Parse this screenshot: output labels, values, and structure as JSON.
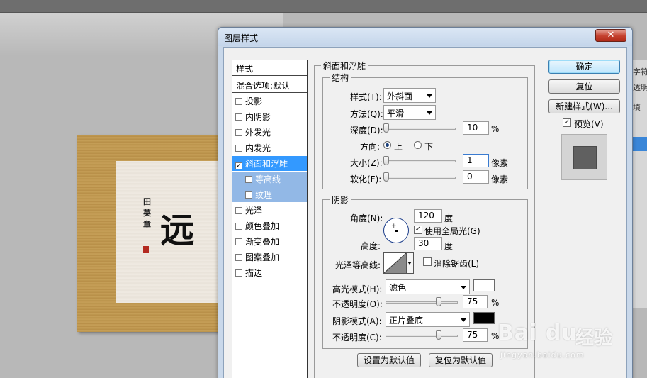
{
  "dialog": {
    "title": "图层样式",
    "close_label": "✕"
  },
  "style_list": {
    "header": "样式",
    "blend_options": "混合选项:默认",
    "items": [
      {
        "label": "投影",
        "checked": false
      },
      {
        "label": "内阴影",
        "checked": false
      },
      {
        "label": "外发光",
        "checked": false
      },
      {
        "label": "内发光",
        "checked": false
      },
      {
        "label": "斜面和浮雕",
        "checked": true
      },
      {
        "label": "等高线",
        "checked": false
      },
      {
        "label": "纹理",
        "checked": false
      },
      {
        "label": "光泽",
        "checked": false
      },
      {
        "label": "颜色叠加",
        "checked": false
      },
      {
        "label": "渐变叠加",
        "checked": false
      },
      {
        "label": "图案叠加",
        "checked": false
      },
      {
        "label": "描边",
        "checked": false
      }
    ],
    "check_mark": "✓"
  },
  "bevel": {
    "group_title": "斜面和浮雕",
    "structure": {
      "title": "结构",
      "style_label": "样式(T):",
      "style_value": "外斜面",
      "technique_label": "方法(Q):",
      "technique_value": "平滑",
      "depth_label": "深度(D):",
      "depth_value": "10",
      "depth_unit": "%",
      "depth_level": 0.01,
      "direction_label": "方向:",
      "direction_up": "上",
      "direction_down": "下",
      "direction_selected": "上",
      "size_label": "大小(Z):",
      "size_value": "1",
      "size_unit": "像素",
      "soften_label": "软化(F):",
      "soften_value": "0",
      "soften_unit": "像素"
    },
    "shading": {
      "title": "阴影",
      "angle_label": "角度(N):",
      "angle_value": "120",
      "angle_unit": "度",
      "global_light_label": "使用全局光(G)",
      "global_light_checked": true,
      "altitude_label": "高度:",
      "altitude_value": "30",
      "altitude_unit": "度",
      "gloss_contour_label": "光泽等高线:",
      "antialias_label": "消除锯齿(L)",
      "antialias_checked": false,
      "highlight_mode_label": "高光模式(H):",
      "highlight_mode_value": "滤色",
      "highlight_color": "#ffffff",
      "highlight_opacity_label": "不透明度(O):",
      "highlight_opacity_value": "75",
      "highlight_opacity_unit": "%",
      "shadow_mode_label": "阴影模式(A):",
      "shadow_mode_value": "正片叠底",
      "shadow_color": "#000000",
      "shadow_opacity_label": "不透明度(C):",
      "shadow_opacity_value": "75",
      "shadow_opacity_unit": "%"
    },
    "make_default_label": "设置为默认值",
    "reset_default_label": "复位为默认值"
  },
  "buttons": {
    "ok": "确定",
    "reset": "复位",
    "new_style": "新建样式(W)...",
    "preview_label": "预览(V)",
    "preview_checked": true
  },
  "canvas": {
    "calligraphy_main": "远",
    "calligraphy_small": "田英章"
  },
  "side_panel": {
    "tab1": "字符",
    "tab2": "透明",
    "tab3": "填"
  },
  "watermark": {
    "logo": "Bai du",
    "cn": "经验",
    "url": "jingyan.baidu.com"
  },
  "colors": {
    "accent": "#3399ff",
    "sub_selected": "#92b8e6",
    "close_red": "#c4402e"
  }
}
